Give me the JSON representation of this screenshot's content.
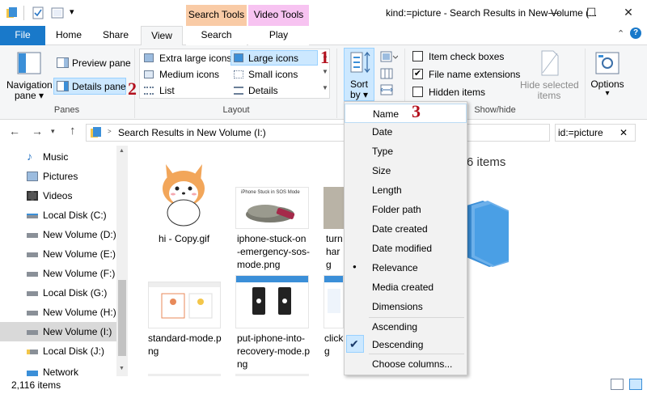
{
  "window": {
    "title": "kind:=picture - Search Results in New Volume (...",
    "context_tabs": [
      "Search Tools",
      "Video Tools"
    ],
    "controls": {
      "minimize": "—",
      "maximize": "☐",
      "close": "✕"
    }
  },
  "tabs": [
    "File",
    "Home",
    "Share",
    "View",
    "Search",
    "Play"
  ],
  "ribbon": {
    "panes": {
      "navigation_pane": "Navigation",
      "navigation_pane_2": "pane ▾",
      "preview_pane": "Preview pane",
      "details_pane": "Details pane",
      "label": "Panes"
    },
    "layout": {
      "options": [
        "Extra large icons",
        "Large icons",
        "Medium icons",
        "Small icons",
        "List",
        "Details"
      ],
      "label": "Layout"
    },
    "sort": {
      "line1": "Sort",
      "line2": "by ▾"
    },
    "show_hide": {
      "item_check_boxes": "Item check boxes",
      "file_name_extensions": "File name extensions",
      "hidden_items": "Hidden items",
      "hide_selected_1": "Hide selected",
      "hide_selected_2": "items",
      "label": "Show/hide"
    },
    "options": {
      "label": "Options",
      "arrow": "▾"
    }
  },
  "address": {
    "path": "Search Results in New Volume (I:)",
    "search_value": "id:=picture",
    "search_clear": "✕"
  },
  "sidebar": {
    "items": [
      "Music",
      "Pictures",
      "Videos",
      "Local Disk (C:)",
      "New Volume (D:)",
      "New Volume (E:)",
      "New Volume (F:)",
      "Local Disk (G:)",
      "New Volume (H:)",
      "New Volume (I:)",
      "Local Disk (J:)",
      "Network"
    ]
  },
  "content": {
    "items_count_partial": "6 items",
    "files": [
      {
        "name": "hi - Copy.gif"
      },
      {
        "name": "iphone-stuck-on-emergency-sos-mode.png",
        "lines": [
          "iphone-stuck-on",
          "-emergency-sos-",
          "mode.png"
        ]
      },
      {
        "name": "turn harg",
        "lines": [
          "turn",
          "harg",
          "g"
        ]
      },
      {
        "name": "standard-mode.png",
        "lines": [
          "standard-mode.p",
          "ng"
        ]
      },
      {
        "name": "put-iphone-into-recovery-mode.png",
        "lines": [
          "put-iphone-into-",
          "recovery-mode.p",
          "ng"
        ]
      },
      {
        "name": "click",
        "lines": [
          "click",
          "g"
        ]
      }
    ],
    "thumb_caption_2": "iPhone Stuck in SOS Mode"
  },
  "status": {
    "count": "2,116 items"
  },
  "sort_menu": {
    "items": [
      "Name",
      "Date",
      "Type",
      "Size",
      "Length",
      "Folder path",
      "Date created",
      "Date modified",
      "Relevance",
      "Media created",
      "Dimensions"
    ],
    "order": [
      "Ascending",
      "Descending"
    ],
    "choose_columns": "Choose columns...",
    "checked_bullet": "●",
    "checked_order": "✔"
  },
  "annotations": [
    "1",
    "2",
    "3"
  ],
  "colors": {
    "accent": "#1979ca",
    "search_tools": "#f9cba6",
    "video_tools": "#f7c3f1",
    "selection": "#cce8ff",
    "annotation": "#b3101d"
  }
}
